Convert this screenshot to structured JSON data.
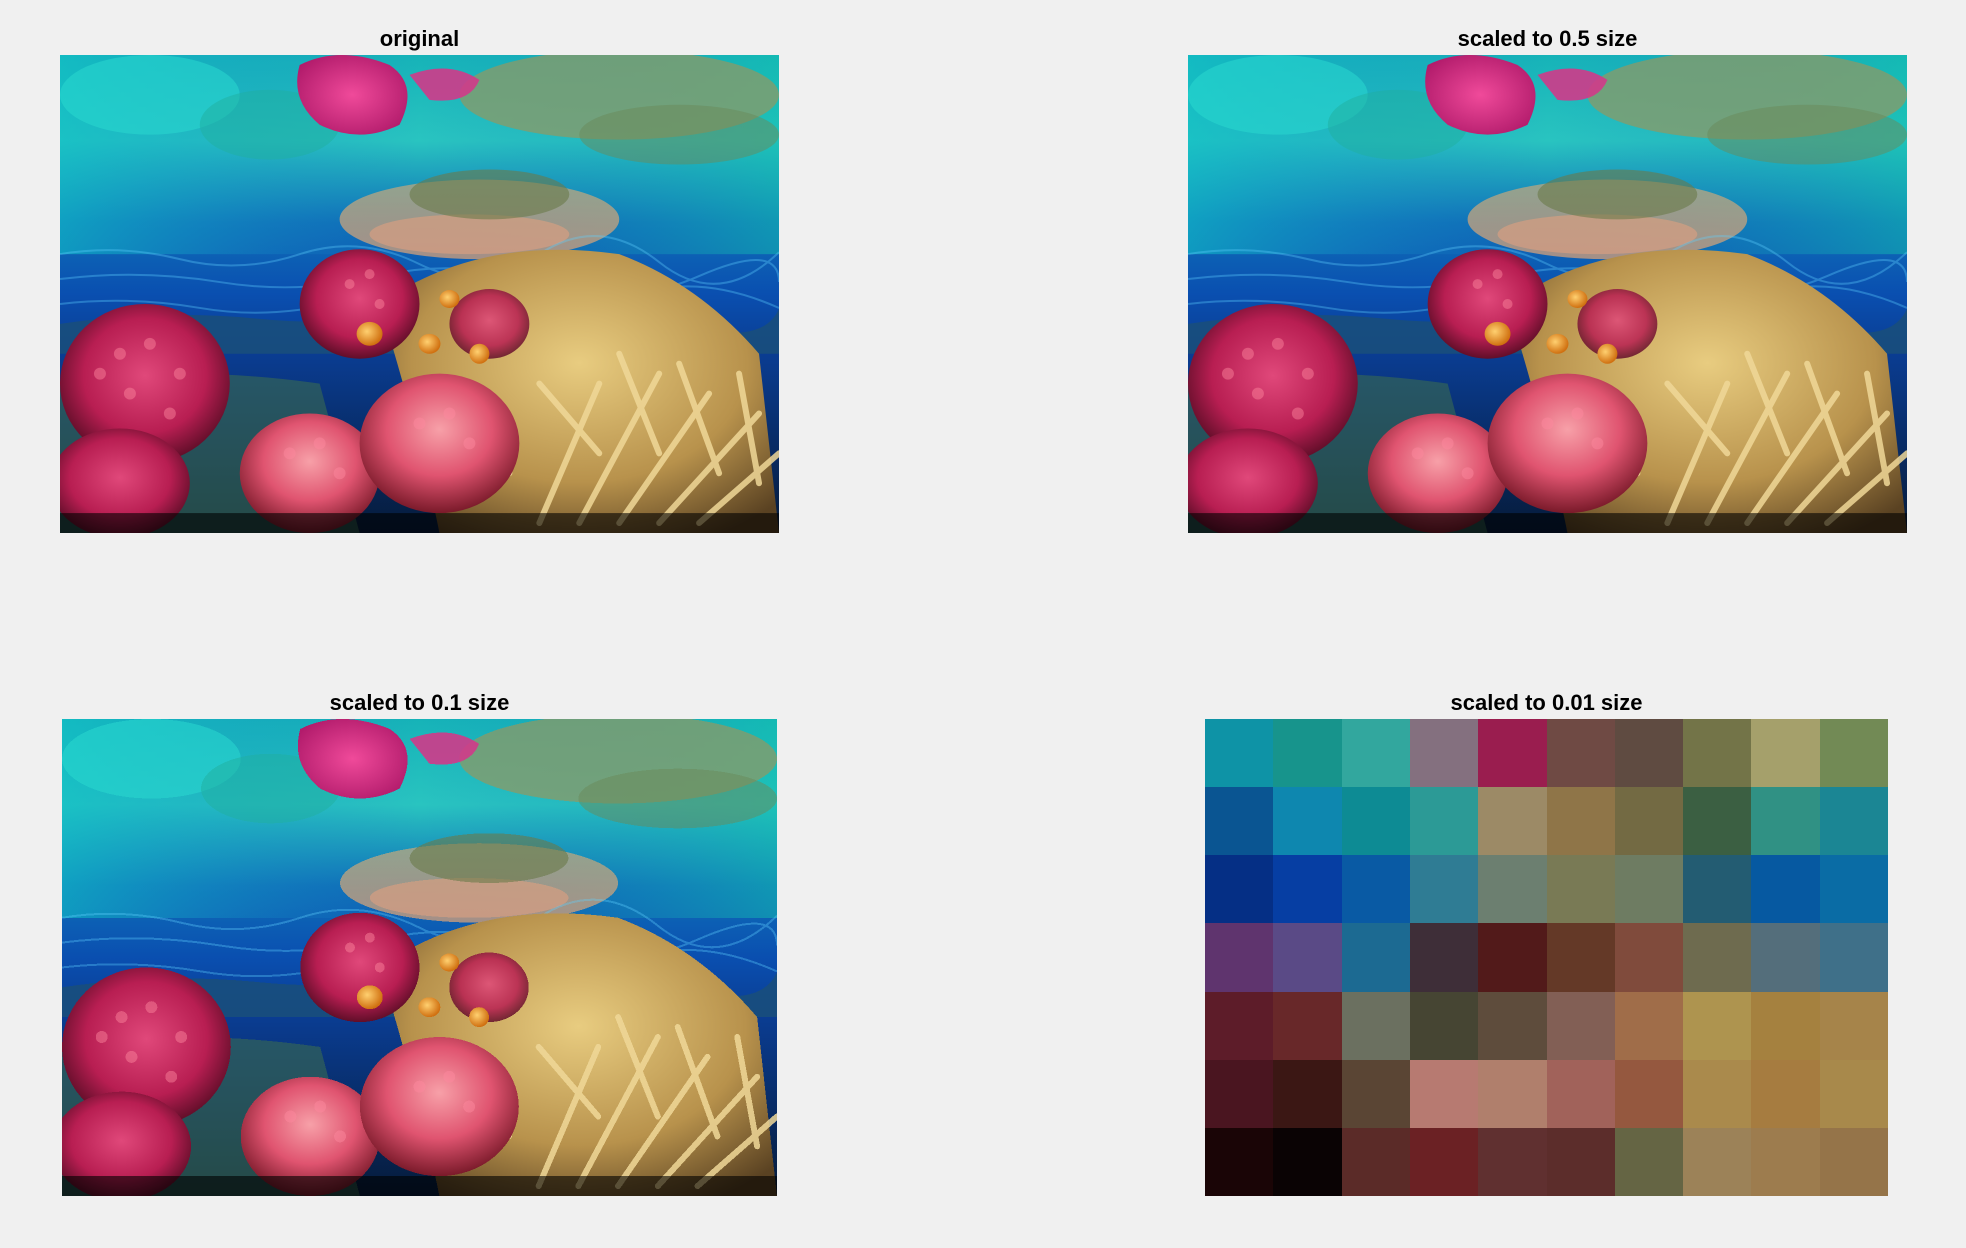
{
  "panels": [
    {
      "title": "original"
    },
    {
      "title": "scaled to 0.5 size"
    },
    {
      "title": "scaled to 0.1 size"
    },
    {
      "title": "scaled to 0.01 size"
    }
  ],
  "low_res_grid": {
    "columns": 10,
    "rows": 7,
    "colors": [
      [
        "#0e93a6",
        "#17948c",
        "#32a79e",
        "#84707f",
        "#9a1d4f",
        "#6f4a44",
        "#5f4b41",
        "#737448",
        "#a5a06b",
        "#728a55"
      ],
      [
        "#0a5592",
        "#0e87af",
        "#0d8b94",
        "#2c9a96",
        "#9c8a66",
        "#8f7548",
        "#736a43",
        "#3b5f42",
        "#309184",
        "#1b8694"
      ],
      [
        "#052f85",
        "#063ea3",
        "#095aa4",
        "#2f7c94",
        "#6c7f70",
        "#797a55",
        "#6e7c62",
        "#235c72",
        "#0659a1",
        "#0a6ca5"
      ],
      [
        "#5f346e",
        "#5a4a86",
        "#1c6a92",
        "#3e2e38",
        "#521a1a",
        "#643927",
        "#804b3c",
        "#6e6b4f",
        "#546e7b",
        "#3f7089"
      ],
      [
        "#5d1c29",
        "#682829",
        "#6b7060",
        "#464533",
        "#5e4c3c",
        "#825f55",
        "#a06d49",
        "#ae944f",
        "#a5813f",
        "#a6844a"
      ],
      [
        "#4a1520",
        "#3b1714",
        "#5a4534",
        "#b77a71",
        "#b07f6c",
        "#a1625a",
        "#95583f",
        "#aa8a4c",
        "#a67c40",
        "#a8894b"
      ],
      [
        "#1a0506",
        "#0a0304",
        "#5b2b28",
        "#6b2124",
        "#603030",
        "#5c2d2b",
        "#656544",
        "#9c8258",
        "#9d7c4e",
        "#957449"
      ]
    ]
  }
}
